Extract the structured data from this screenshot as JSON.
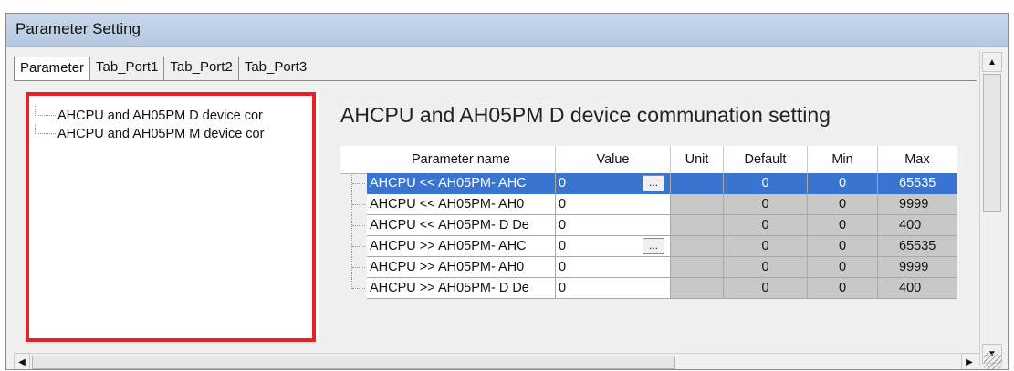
{
  "window": {
    "title": "Parameter Setting"
  },
  "tabs": [
    "Parameter",
    "Tab_Port1",
    "Tab_Port2",
    "Tab_Port3"
  ],
  "tree": {
    "items": [
      "AHCPU and AH05PM D device cor",
      "AHCPU and AH05PM M device cor"
    ]
  },
  "section": {
    "title": "AHCPU and AH05PM D device communation setting"
  },
  "grid": {
    "columns": [
      "Parameter name",
      "Value",
      "Unit",
      "Default",
      "Min",
      "Max"
    ],
    "rows": [
      {
        "name": "AHCPU << AH05PM- AHC",
        "value": "0",
        "unit": "",
        "default": "0",
        "min": "0",
        "max": "65535",
        "has_button": true,
        "selected": true
      },
      {
        "name": "AHCPU << AH05PM- AH0",
        "value": "0",
        "unit": "",
        "default": "0",
        "min": "0",
        "max": "9999",
        "has_button": false,
        "selected": false
      },
      {
        "name": "AHCPU << AH05PM- D De",
        "value": "0",
        "unit": "",
        "default": "0",
        "min": "0",
        "max": "400",
        "has_button": false,
        "selected": false
      },
      {
        "name": "AHCPU >> AH05PM- AHC",
        "value": "0",
        "unit": "",
        "default": "0",
        "min": "0",
        "max": "65535",
        "has_button": true,
        "selected": false
      },
      {
        "name": "AHCPU >> AH05PM- AH0",
        "value": "0",
        "unit": "",
        "default": "0",
        "min": "0",
        "max": "9999",
        "has_button": false,
        "selected": false
      },
      {
        "name": "AHCPU >> AH05PM- D De",
        "value": "0",
        "unit": "",
        "default": "0",
        "min": "0",
        "max": "400",
        "has_button": false,
        "selected": false
      }
    ],
    "ellipsis_label": "..."
  },
  "icons": {
    "scroll_up": "arrow-up-icon",
    "scroll_down": "arrow-down-icon",
    "scroll_left": "arrow-left-icon",
    "scroll_right": "arrow-right-icon"
  },
  "colors": {
    "selection": "#3874d0",
    "highlight_box": "#e42328",
    "readonly_cell": "#c8c8c8"
  }
}
